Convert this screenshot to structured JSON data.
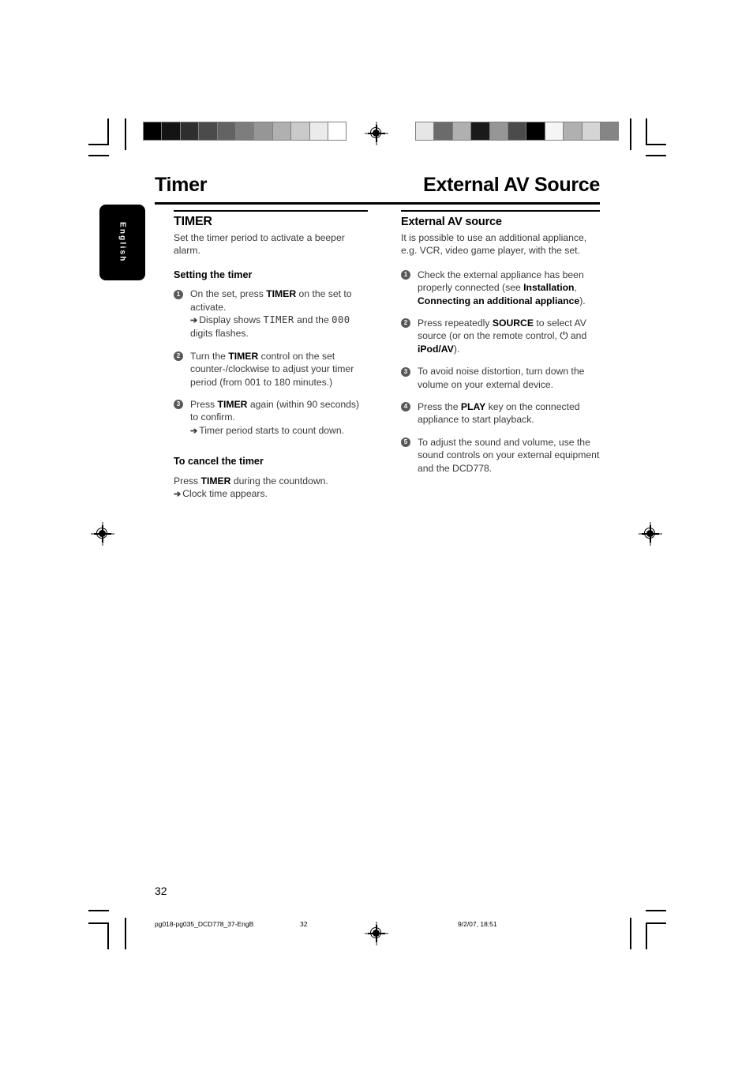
{
  "document": {
    "running_head_left": "Timer",
    "running_head_right": "External AV Source",
    "language_tab": "English",
    "folio": "32"
  },
  "left_column": {
    "section_title": "TIMER",
    "intro": "Set the timer period to activate a beeper alarm.",
    "subheading_setting": "Setting the timer",
    "steps": [
      {
        "num": "1",
        "line1_a": "On the set, press ",
        "line1_bold": "TIMER",
        "line1_b": " on the set to activate.",
        "arrow_a": "Display shows ",
        "arrow_lcd1": "TIMER",
        "arrow_b": " and the ",
        "arrow_lcd2": "000",
        "arrow_c": " digits flashes."
      },
      {
        "num": "2",
        "line1_a": "Turn the ",
        "line1_bold": "TIMER",
        "line1_b": " control on the set counter-/clockwise to adjust your timer period (from 001 to 180 minutes.)"
      },
      {
        "num": "3",
        "line1_a": "Press ",
        "line1_bold": "TIMER",
        "line1_b": " again (within 90 seconds) to confirm.",
        "arrow_a": "Timer period starts to count down."
      }
    ],
    "subheading_cancel": "To cancel the timer",
    "cancel_a": "Press ",
    "cancel_bold": "TIMER",
    "cancel_b": " during the countdown.",
    "cancel_arrow": "Clock time appears."
  },
  "right_column": {
    "section_title": "External AV source",
    "intro": "It is possible to use an additional appliance, e.g. VCR, video game player, with the set.",
    "steps": [
      {
        "num": "1",
        "text_a": "Check the external appliance has been properly connected (see ",
        "bold1": "Installation",
        "text_b": ", ",
        "bold2": "Connecting an additional appliance",
        "text_c": ")."
      },
      {
        "num": "2",
        "text_a": "Press repeatedly ",
        "bold1": "SOURCE",
        "text_b": " to select AV source (or on the remote control, ",
        "icon": "⏻",
        "text_c": " and ",
        "bold2": "iPod/AV",
        "text_d": ")."
      },
      {
        "num": "3",
        "text_a": "To avoid noise distortion, turn down the volume on your external device."
      },
      {
        "num": "4",
        "text_a": "Press the ",
        "bold1": "PLAY",
        "text_b": " key on the connected appliance to start playback."
      },
      {
        "num": "5",
        "text_a": "To adjust the sound and volume, use the sound controls on your external equipment and the DCD778."
      }
    ]
  },
  "footer": {
    "file_slug": "pg018-pg035_DCD778_37-EngB",
    "page_number": "32",
    "timestamp": "9/2/07, 18:51"
  },
  "print_marks": {
    "arrow_glyph": "➔",
    "colorbar_left": [
      "#000000",
      "#141414",
      "#2e2e2e",
      "#4b4b4b",
      "#636363",
      "#7d7d7d",
      "#969696",
      "#b0b0b0",
      "#cacaca",
      "#ebebeb",
      "#ffffff"
    ],
    "colorbar_right": [
      "#e6e6e6",
      "#6b6b6b",
      "#b0b0b0",
      "#1a1a1a",
      "#969696",
      "#4b4b4b",
      "#000000",
      "#f5f5f5",
      "#b0b0b0",
      "#d5d5d5",
      "#858585"
    ]
  }
}
